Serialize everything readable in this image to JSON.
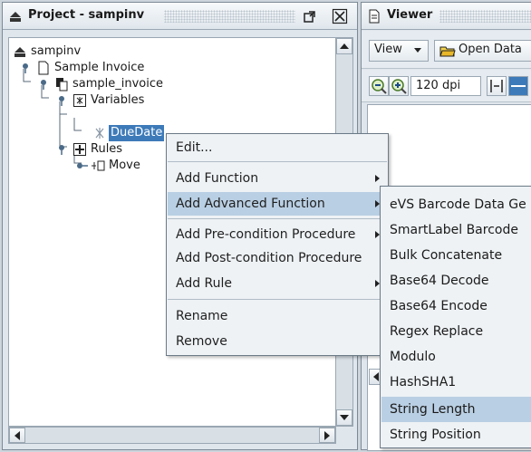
{
  "project_panel": {
    "title": "Project - sampinv",
    "tree": {
      "root": "sampinv",
      "sample_invoice": "Sample Invoice",
      "sample_invoice_lower": "sample_invoice",
      "variables": "Variables",
      "duedate": "DueDate",
      "rules": "Rules",
      "move": "Move"
    }
  },
  "viewer_panel": {
    "title": "Viewer",
    "view_combo": "View",
    "open_data_button": "Open Data",
    "dpi_value": "120 dpi"
  },
  "context_menu": {
    "items": [
      {
        "label": "Edit...",
        "submenu": false,
        "highlighted": false
      },
      {
        "label": "Add Function",
        "submenu": true,
        "highlighted": false
      },
      {
        "label": "Add Advanced Function",
        "submenu": true,
        "highlighted": true
      },
      {
        "label": "Add Pre-condition Procedure",
        "submenu": true,
        "highlighted": false
      },
      {
        "label": "Add Post-condition Procedure",
        "submenu": true,
        "highlighted": false
      },
      {
        "label": "Add Rule",
        "submenu": true,
        "highlighted": false
      },
      {
        "label": "Rename",
        "submenu": false,
        "highlighted": false
      },
      {
        "label": "Remove",
        "submenu": false,
        "highlighted": false
      }
    ]
  },
  "submenu": {
    "items": [
      {
        "label": "eVS Barcode Data Ge",
        "highlighted": false
      },
      {
        "label": "SmartLabel Barcode",
        "highlighted": false
      },
      {
        "label": "Bulk Concatenate",
        "highlighted": false
      },
      {
        "label": "Base64 Decode",
        "highlighted": false
      },
      {
        "label": "Base64 Encode",
        "highlighted": false
      },
      {
        "label": "Regex Replace",
        "highlighted": false
      },
      {
        "label": "Modulo",
        "highlighted": false
      },
      {
        "label": "HashSHA1",
        "highlighted": false
      },
      {
        "label": "String Length",
        "highlighted": true
      },
      {
        "label": "String Position",
        "highlighted": false
      }
    ]
  },
  "colors": {
    "selection": "#3d7ab9",
    "menu_highlight": "#b9cfe3",
    "panel_bg": "#dfe6ec"
  }
}
